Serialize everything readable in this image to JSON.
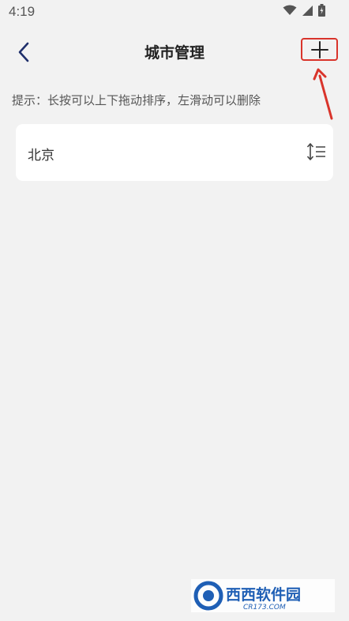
{
  "status_bar": {
    "time": "4:19",
    "icons": [
      "wifi-icon",
      "signal-icon",
      "battery-icon"
    ]
  },
  "header": {
    "title": "城市管理",
    "back_icon": "chevron-left-icon",
    "add_icon": "plus-icon"
  },
  "hint": "提示：长按可以上下拖动排序，左滑动可以删除",
  "cities": [
    {
      "name": "北京",
      "handle_icon": "sort-handle-icon"
    }
  ],
  "colors": {
    "background": "#f2f2f2",
    "card": "#ffffff",
    "accent_back": "#1f2f6b",
    "annotation": "#d9342b"
  },
  "watermark": {
    "brand": "西西软件园",
    "url": "CR173.COM"
  }
}
